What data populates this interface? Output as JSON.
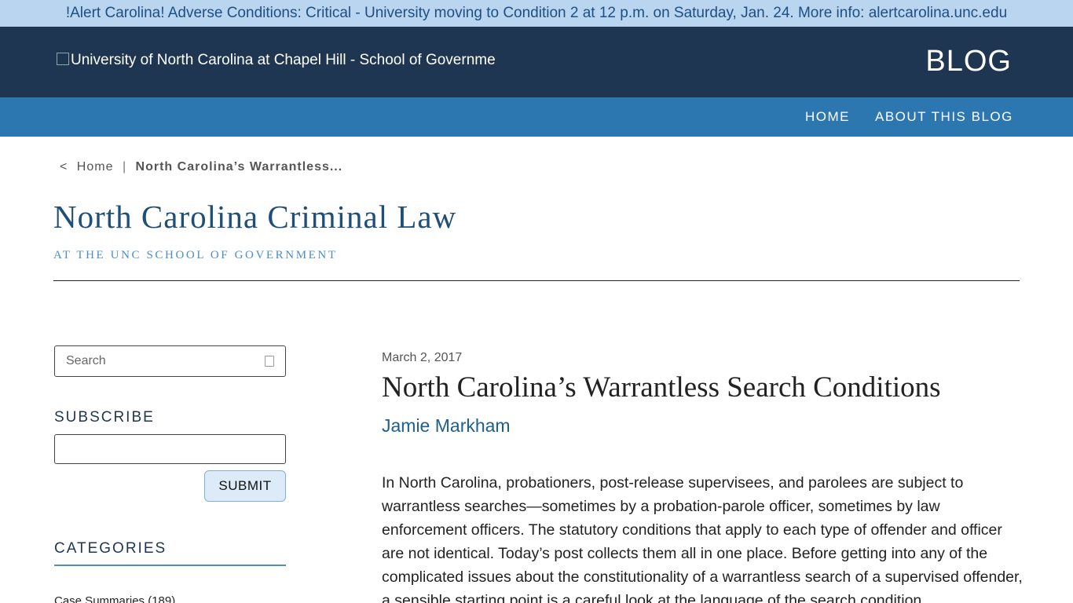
{
  "alert": {
    "text": "!Alert Carolina! Adverse Conditions: Critical - University moving to Condition 2 at 12 p.m. on Saturday, Jan. 24. More info: alertcarolina.unc.edu"
  },
  "header": {
    "logo_alt": "University of North Carolina at Chapel Hill - School of Governme",
    "blog_label": "BLOG"
  },
  "nav": {
    "items": [
      {
        "label": "HOME"
      },
      {
        "label": "ABOUT THIS BLOG"
      }
    ]
  },
  "breadcrumb": {
    "back_symbol": "<",
    "home": "Home",
    "separator": "|",
    "current": "North Carolina’s Warrantless..."
  },
  "blog": {
    "title": "North Carolina Criminal Law",
    "subtitle": "AT THE UNC SCHOOL OF GOVERNMENT"
  },
  "sidebar": {
    "search_placeholder": "Search",
    "subscribe_heading": "SUBSCRIBE",
    "submit_label": "SUBMIT",
    "categories_heading": "CATEGORIES",
    "categories": [
      {
        "label": "Case Summaries (189)"
      }
    ]
  },
  "post": {
    "date": "March 2, 2017",
    "title": "North Carolina’s Warrantless Search Conditions",
    "author": "Jamie Markham",
    "body": "In North Carolina, probationers, post-release supervisees, and parolees are subject to warrantless searches—sometimes by a probation-parole officer, sometimes by law enforcement officers. The statutory conditions that apply to each type of offender and officer are not identical. Today’s post collects them all in one place. Before getting into any of the complicated issues about the constitutionality of a warrantless search of a supervised offender, a sensible starting point is a careful look at the language of the search condition"
  },
  "colors": {
    "alert_bg": "#b9d5ef",
    "header_bg": "#1f3653",
    "nav_bg": "#2c77b0",
    "title_blue": "#1f4f78",
    "accent_blue": "#4d8ec4"
  }
}
